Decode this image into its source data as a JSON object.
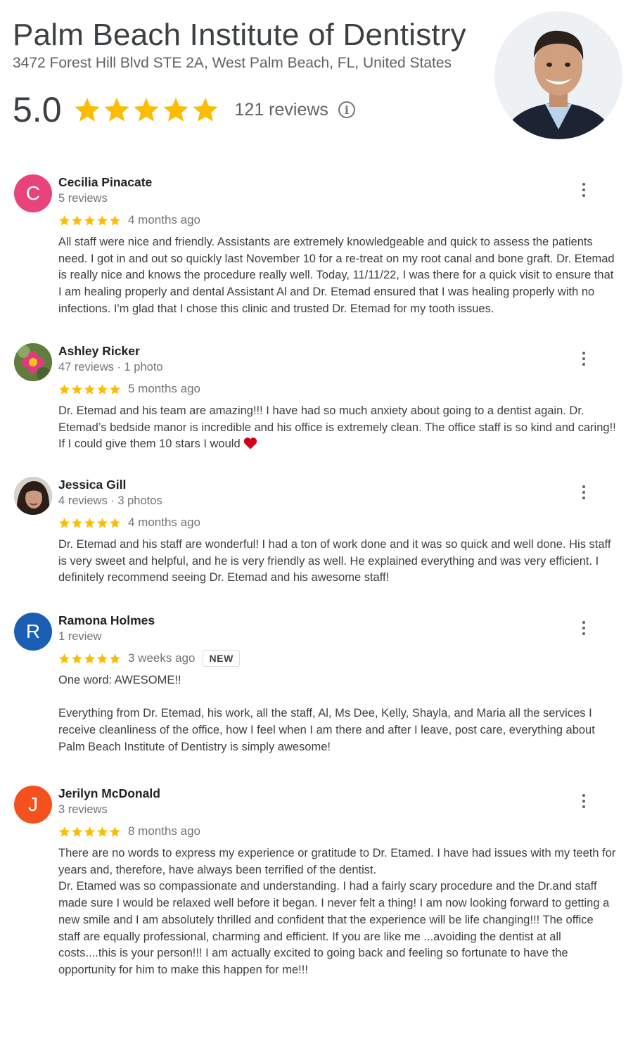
{
  "business": {
    "name": "Palm Beach Institute of Dentistry",
    "address": "3472 Forest Hill Blvd STE 2A, West Palm Beach, FL, United States",
    "rating": "5.0",
    "stars": 5,
    "review_count": "121 reviews",
    "star_color": "#fbbc04"
  },
  "icons": {
    "info": "info-icon",
    "more": "more-vert-icon",
    "star": "star-icon",
    "heart": "heart-icon"
  },
  "reviews": [
    {
      "initial": "C",
      "avatar_color": "#e9437c",
      "name": "Cecilia Pinacate",
      "meta": "5 reviews",
      "stars": 5,
      "time": "4 months ago",
      "text": "All staff were nice and friendly. Assistants are extremely knowledgeable and quick to assess the patients need. I  got in and out so quickly last November 10 for a re-treat on my root canal and bone graft. Dr. Etemad is really nice and knows the procedure really well. Today, 11/11/22, I was there for a quick visit to ensure that I am healing properly and dental Assistant Al and Dr. Etemad ensured that I was healing properly with no infections. I'm glad that I chose this clinic and trusted Dr. Etemad for my tooth issues."
    },
    {
      "initial": "",
      "avatar_color": "#6d8a45",
      "name": "Ashley Ricker",
      "meta": "47 reviews · 1 photo",
      "stars": 5,
      "time": "5 months ago",
      "text": "Dr. Etemad and his team are amazing!!! I have had so much anxiety about going to a dentist again. Dr. Etemad’s bedside manor is incredible and his office is extremely clean. The office staff is so kind and caring!! If I could give them 10 stars I would"
    },
    {
      "initial": "",
      "avatar_color": "#8a6a58",
      "name": "Jessica Gill",
      "meta": "4 reviews · 3 photos",
      "stars": 5,
      "time": "4 months ago",
      "text": "Dr. Etemad and his staff are wonderful! I had a ton of work done and it was so quick and well done. His staff is very sweet and helpful, and he is very friendly as well. He explained everything and was very efficient. I definitely recommend seeing Dr. Etemad and his awesome staff!"
    },
    {
      "initial": "R",
      "avatar_color": "#1a5fb4",
      "name": "Ramona Holmes",
      "meta": "1 review",
      "stars": 5,
      "time": "3 weeks ago",
      "badge": "NEW",
      "text": "One word: AWESOME!!\n\nEverything from Dr. Etemad, his work,  all the staff, Al, Ms Dee, Kelly, Shayla, and Maria all the services I receive cleanliness of the office, how I feel when I am there and after I leave, post care, everything about Palm Beach Institute of Dentistry is simply awesome!"
    },
    {
      "initial": "J",
      "avatar_color": "#f4511e",
      "name": "Jerilyn McDonald",
      "meta": "3 reviews",
      "stars": 5,
      "time": "8 months ago",
      "text": "There are no words to express my experience or gratitude to Dr. Etamed. I have had issues with my teeth for years and, therefore, have always been terrified of the dentist.\nDr. Etamed was so compassionate and understanding.  I had a fairly scary procedure and the Dr.and staff made sure I would be relaxed well before it began. I never felt a thing! I am now looking forward to getting a new smile and I am absolutely thrilled and confident that the experience will be life changing!!! The office staff are equally professional,  charming and efficient. If you are like me ...avoiding the dentist at all costs....this is your person!!! I am actually excited to going back and feeling so fortunate to have the opportunity for him to make this happen for me!!!"
    }
  ]
}
